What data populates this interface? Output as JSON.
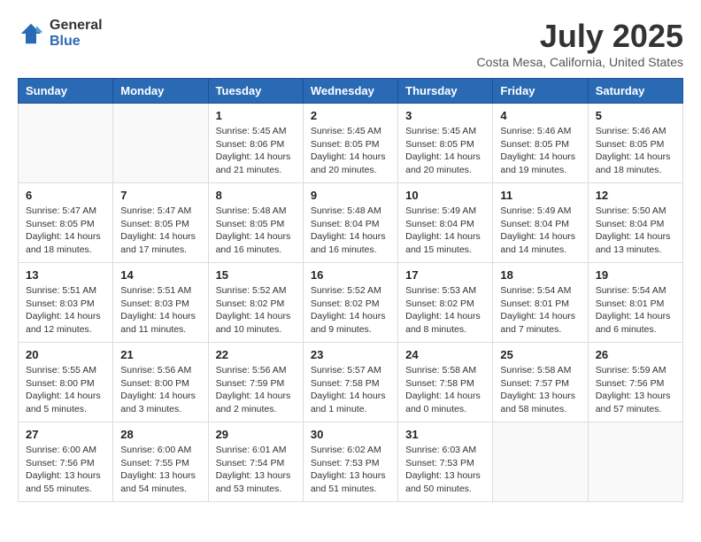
{
  "header": {
    "logo": {
      "general": "General",
      "blue": "Blue"
    },
    "title": "July 2025",
    "subtitle": "Costa Mesa, California, United States"
  },
  "columns": [
    "Sunday",
    "Monday",
    "Tuesday",
    "Wednesday",
    "Thursday",
    "Friday",
    "Saturday"
  ],
  "weeks": [
    [
      {
        "day": "",
        "empty": true
      },
      {
        "day": "",
        "empty": true
      },
      {
        "day": "1",
        "sunrise": "5:45 AM",
        "sunset": "8:06 PM",
        "daylight": "14 hours and 21 minutes."
      },
      {
        "day": "2",
        "sunrise": "5:45 AM",
        "sunset": "8:05 PM",
        "daylight": "14 hours and 20 minutes."
      },
      {
        "day": "3",
        "sunrise": "5:45 AM",
        "sunset": "8:05 PM",
        "daylight": "14 hours and 20 minutes."
      },
      {
        "day": "4",
        "sunrise": "5:46 AM",
        "sunset": "8:05 PM",
        "daylight": "14 hours and 19 minutes."
      },
      {
        "day": "5",
        "sunrise": "5:46 AM",
        "sunset": "8:05 PM",
        "daylight": "14 hours and 18 minutes."
      }
    ],
    [
      {
        "day": "6",
        "sunrise": "5:47 AM",
        "sunset": "8:05 PM",
        "daylight": "14 hours and 18 minutes."
      },
      {
        "day": "7",
        "sunrise": "5:47 AM",
        "sunset": "8:05 PM",
        "daylight": "14 hours and 17 minutes."
      },
      {
        "day": "8",
        "sunrise": "5:48 AM",
        "sunset": "8:05 PM",
        "daylight": "14 hours and 16 minutes."
      },
      {
        "day": "9",
        "sunrise": "5:48 AM",
        "sunset": "8:04 PM",
        "daylight": "14 hours and 16 minutes."
      },
      {
        "day": "10",
        "sunrise": "5:49 AM",
        "sunset": "8:04 PM",
        "daylight": "14 hours and 15 minutes."
      },
      {
        "day": "11",
        "sunrise": "5:49 AM",
        "sunset": "8:04 PM",
        "daylight": "14 hours and 14 minutes."
      },
      {
        "day": "12",
        "sunrise": "5:50 AM",
        "sunset": "8:04 PM",
        "daylight": "14 hours and 13 minutes."
      }
    ],
    [
      {
        "day": "13",
        "sunrise": "5:51 AM",
        "sunset": "8:03 PM",
        "daylight": "14 hours and 12 minutes."
      },
      {
        "day": "14",
        "sunrise": "5:51 AM",
        "sunset": "8:03 PM",
        "daylight": "14 hours and 11 minutes."
      },
      {
        "day": "15",
        "sunrise": "5:52 AM",
        "sunset": "8:02 PM",
        "daylight": "14 hours and 10 minutes."
      },
      {
        "day": "16",
        "sunrise": "5:52 AM",
        "sunset": "8:02 PM",
        "daylight": "14 hours and 9 minutes."
      },
      {
        "day": "17",
        "sunrise": "5:53 AM",
        "sunset": "8:02 PM",
        "daylight": "14 hours and 8 minutes."
      },
      {
        "day": "18",
        "sunrise": "5:54 AM",
        "sunset": "8:01 PM",
        "daylight": "14 hours and 7 minutes."
      },
      {
        "day": "19",
        "sunrise": "5:54 AM",
        "sunset": "8:01 PM",
        "daylight": "14 hours and 6 minutes."
      }
    ],
    [
      {
        "day": "20",
        "sunrise": "5:55 AM",
        "sunset": "8:00 PM",
        "daylight": "14 hours and 5 minutes."
      },
      {
        "day": "21",
        "sunrise": "5:56 AM",
        "sunset": "8:00 PM",
        "daylight": "14 hours and 3 minutes."
      },
      {
        "day": "22",
        "sunrise": "5:56 AM",
        "sunset": "7:59 PM",
        "daylight": "14 hours and 2 minutes."
      },
      {
        "day": "23",
        "sunrise": "5:57 AM",
        "sunset": "7:58 PM",
        "daylight": "14 hours and 1 minute."
      },
      {
        "day": "24",
        "sunrise": "5:58 AM",
        "sunset": "7:58 PM",
        "daylight": "14 hours and 0 minutes."
      },
      {
        "day": "25",
        "sunrise": "5:58 AM",
        "sunset": "7:57 PM",
        "daylight": "13 hours and 58 minutes."
      },
      {
        "day": "26",
        "sunrise": "5:59 AM",
        "sunset": "7:56 PM",
        "daylight": "13 hours and 57 minutes."
      }
    ],
    [
      {
        "day": "27",
        "sunrise": "6:00 AM",
        "sunset": "7:56 PM",
        "daylight": "13 hours and 55 minutes."
      },
      {
        "day": "28",
        "sunrise": "6:00 AM",
        "sunset": "7:55 PM",
        "daylight": "13 hours and 54 minutes."
      },
      {
        "day": "29",
        "sunrise": "6:01 AM",
        "sunset": "7:54 PM",
        "daylight": "13 hours and 53 minutes."
      },
      {
        "day": "30",
        "sunrise": "6:02 AM",
        "sunset": "7:53 PM",
        "daylight": "13 hours and 51 minutes."
      },
      {
        "day": "31",
        "sunrise": "6:03 AM",
        "sunset": "7:53 PM",
        "daylight": "13 hours and 50 minutes."
      },
      {
        "day": "",
        "empty": true
      },
      {
        "day": "",
        "empty": true
      }
    ]
  ]
}
